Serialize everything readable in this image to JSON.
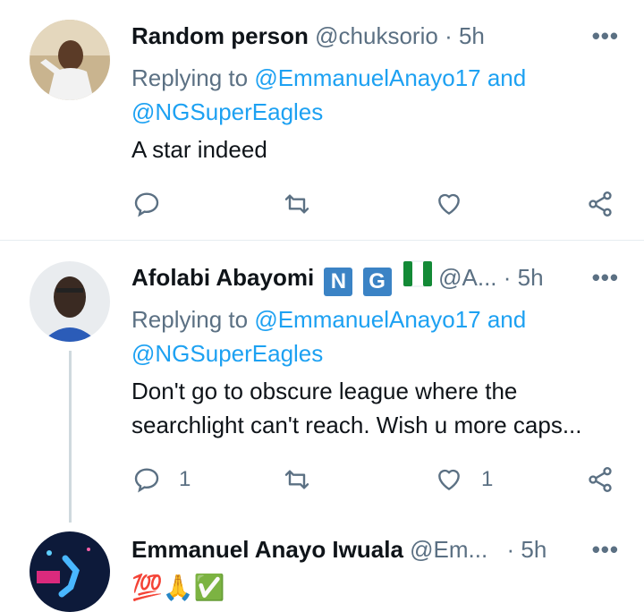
{
  "tweets": [
    {
      "name": "Random person",
      "handle": "@chuksorio",
      "time": "5h",
      "replying_prefix": "Replying to ",
      "reply_to_1": "@EmmanuelAnayo17",
      "reply_and": " and",
      "reply_to_2": "@NGSuperEagles",
      "text": "A star indeed",
      "reply_count": "",
      "like_count": ""
    },
    {
      "name": "Afolabi Abayomi",
      "badges": [
        "N",
        "G"
      ],
      "handle": "@A...",
      "time": "5h",
      "replying_prefix": "Replying to ",
      "reply_to_1": "@EmmanuelAnayo17",
      "reply_and": " and",
      "reply_to_2": "@NGSuperEagles",
      "text_line1": "Don't go to obscure league where the",
      "text_line2": "searchlight can't reach. Wish u more caps...",
      "reply_count": "1",
      "like_count": "1"
    },
    {
      "name": "Emmanuel Anayo Iwuala",
      "handle": "@Em...",
      "time": "5h",
      "text": "💯🙏✅"
    }
  ],
  "separator_dot": "·",
  "more_glyph": "•••",
  "colors": {
    "mention": "#1da1f2",
    "muted": "#5b7083",
    "divider": "#e6ecf0",
    "thread": "#cfd9de",
    "badge": "#3b83c5",
    "flag_green": "#138a36"
  }
}
